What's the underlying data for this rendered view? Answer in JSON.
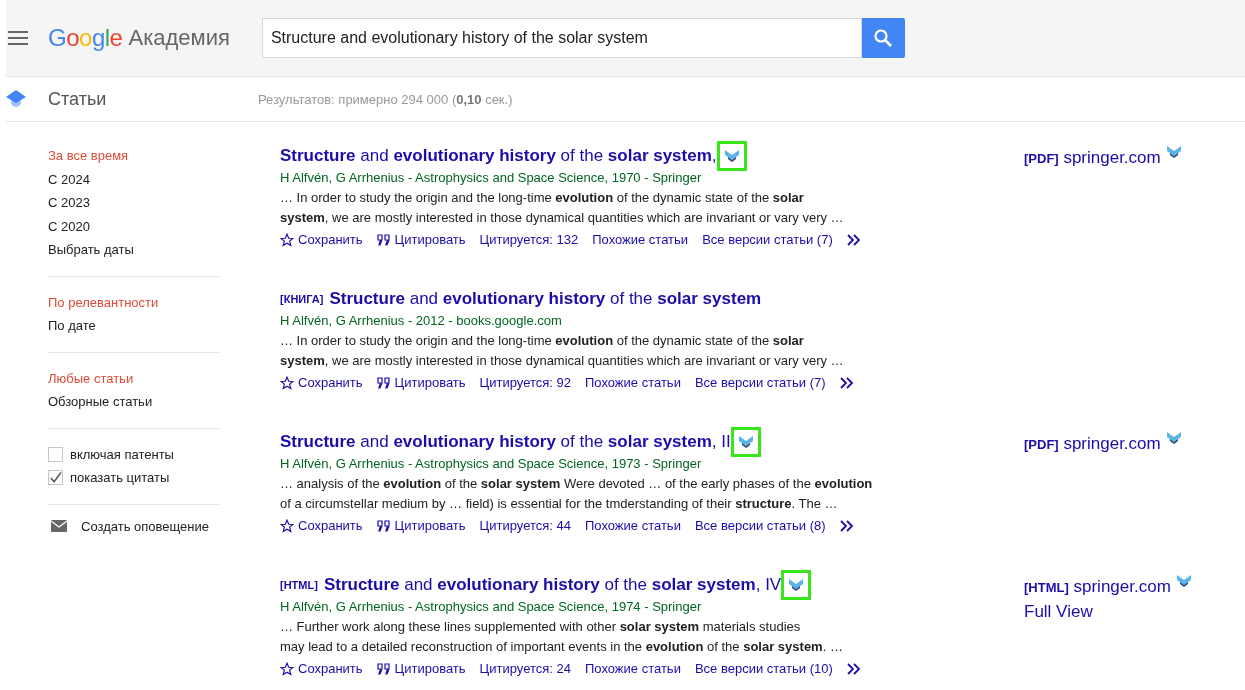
{
  "header": {
    "logo": "Google",
    "product": "Академия",
    "search_value": "Structure and evolutionary history of the solar system"
  },
  "subheader": {
    "section": "Статьи",
    "results": "Результатов: примерно 294 000 (**0,10** сек.)"
  },
  "sidebar": {
    "groups": [
      {
        "items": [
          {
            "label": "За все время",
            "selected": true
          },
          {
            "label": "С 2024",
            "selected": false
          },
          {
            "label": "С 2023",
            "selected": false
          },
          {
            "label": "С 2020",
            "selected": false
          },
          {
            "label": "Выбрать даты",
            "selected": false
          }
        ]
      },
      {
        "items": [
          {
            "label": "По релевантности",
            "selected": true
          },
          {
            "label": "По дате",
            "selected": false
          }
        ]
      },
      {
        "items": [
          {
            "label": "Любые статьи",
            "selected": true
          },
          {
            "label": "Обзорные статьи",
            "selected": false
          }
        ]
      }
    ],
    "checkboxes": [
      {
        "label": "включая патенты",
        "checked": false
      },
      {
        "label": "показать цитаты",
        "checked": true
      }
    ],
    "alert": "Создать оповещение"
  },
  "results": [
    {
      "title": "**Structure** and **evolutionary history** of the **solar system**, ",
      "highlighted": true,
      "meta": "H Alfvén, G Arrhenius - Astrophysics and Space Science, 1970 - Springer",
      "snippet": [
        "… In order to study the origin and the long-time **evolution** of the dynamic state of the **solar**",
        "**system**, we are mostly interested in those dynamical quantities which are invariant or vary very …"
      ],
      "actions": [
        "Сохранить",
        "Цитировать",
        "Цитируется: 132",
        "Похожие статьи",
        "Все версии статьи (7)"
      ],
      "side": {
        "tag": "[PDF]",
        "domain": "springer.com"
      }
    },
    {
      "tag": "[КНИГА]",
      "title": "**Structure** and **evolutionary history** of the **solar system**",
      "meta": "H Alfvén, G Arrhenius - 2012 - books.google.com",
      "snippet": [
        "… In order to study the origin and the long-time **evolution** of the dynamic state of the **solar**",
        "**system**, we are mostly interested in those dynamical quantities which are invariant or vary very …"
      ],
      "actions": [
        "Сохранить",
        "Цитировать",
        "Цитируется: 92",
        "Похожие статьи",
        "Все версии статьи (7)"
      ]
    },
    {
      "title": "**Structure** and **evolutionary history** of the **solar system**, II",
      "highlighted": true,
      "meta": "H Alfvén, G Arrhenius - Astrophysics and Space Science, 1973 - Springer",
      "snippet": [
        "… analysis of the **evolution** of the **solar system** Were devoted … of the early phases of the **evolution**",
        "of a circumstellar medium by … field) is essential for the tmderstanding of their **structure**. The …"
      ],
      "actions": [
        "Сохранить",
        "Цитировать",
        "Цитируется: 44",
        "Похожие статьи",
        "Все версии статьи (8)"
      ],
      "side": {
        "tag": "[PDF]",
        "domain": "springer.com"
      }
    },
    {
      "tag": "[HTML]",
      "title": "**Structure** and **evolutionary history** of the **solar system**, IV",
      "highlighted": true,
      "meta": "H Alfvén, G Arrhenius - Astrophysics and Space Science, 1974 - Springer",
      "snippet": [
        "… Further work along these lines supplemented with other **solar system** materials studies",
        "may lead to a detailed reconstruction of important events in the **evolution** of the **solar system**. …"
      ],
      "actions": [
        "Сохранить",
        "Цитировать",
        "Цитируется: 24",
        "Похожие статьи",
        "Все версии статьи (10)"
      ],
      "side": {
        "tag": "[HTML]",
        "domain": "springer.com",
        "extra": "Full View"
      }
    }
  ]
}
